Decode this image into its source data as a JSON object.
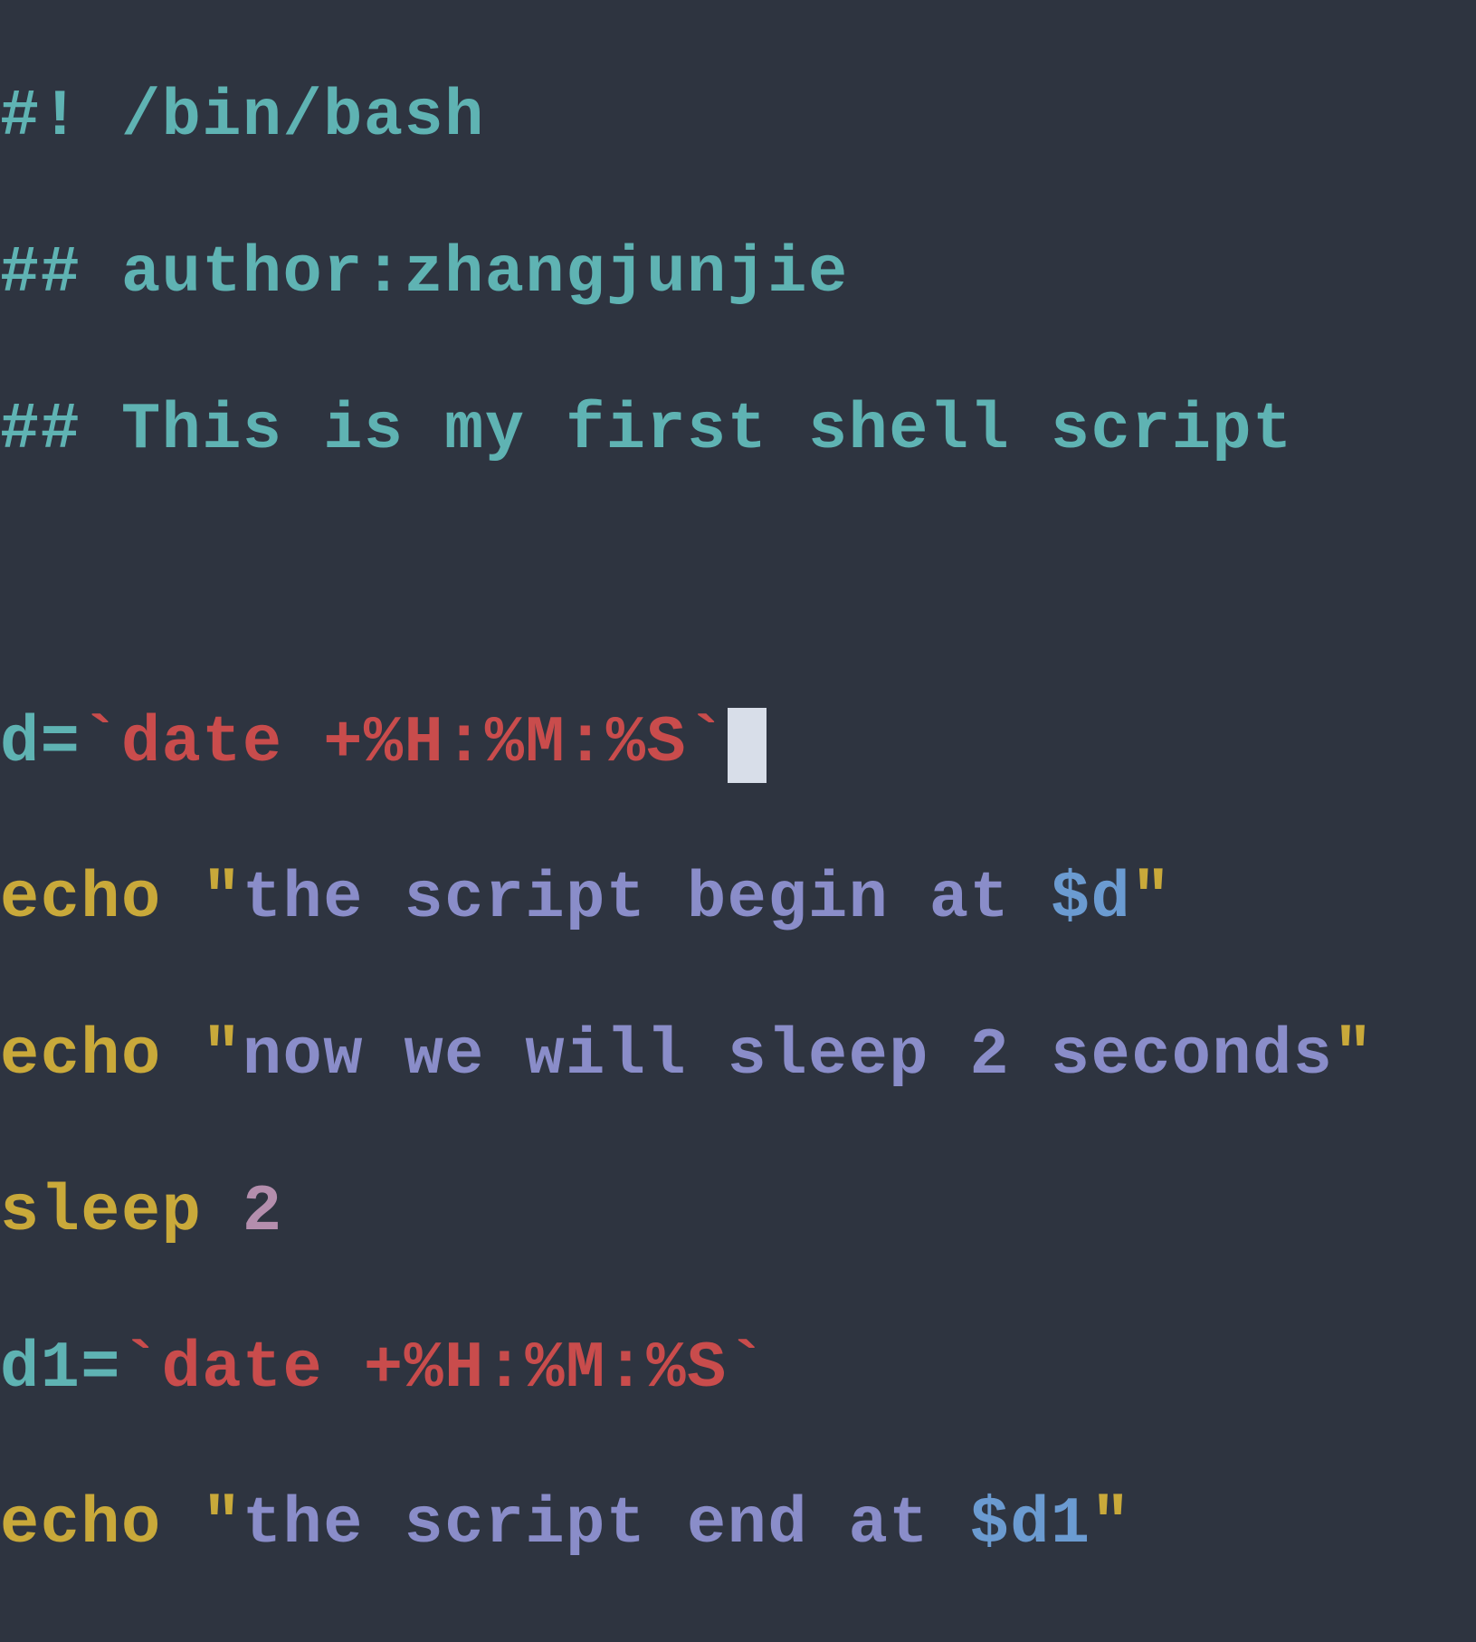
{
  "code": {
    "line1": {
      "shebang": "#! /bin/bash"
    },
    "line2": {
      "hash": "## ",
      "text": "author:zhangjunjie"
    },
    "line3": {
      "hash": "## ",
      "text": "This is my first shell script"
    },
    "line4": "",
    "line5": {
      "var": "d",
      "eq": "=",
      "tick1": "`",
      "cmd": "date +%H:%M:%S",
      "tick2": "`"
    },
    "line6": {
      "echo": "echo ",
      "q1": "\"",
      "str1": "the script begin at ",
      "var": "$d",
      "q2": "\""
    },
    "line7": {
      "echo": "echo ",
      "q1": "\"",
      "str": "now we will sleep 2 seconds",
      "q2": "\""
    },
    "line8": {
      "sleep": "sleep ",
      "num": "2"
    },
    "line9": {
      "var": "d1",
      "eq": "=",
      "tick1": "`",
      "cmd": "date +%H:%M:%S",
      "tick2": "`"
    },
    "line10": {
      "echo": "echo ",
      "q1": "\"",
      "str1": "the script end at ",
      "var": "$d1",
      "q2": "\""
    }
  }
}
